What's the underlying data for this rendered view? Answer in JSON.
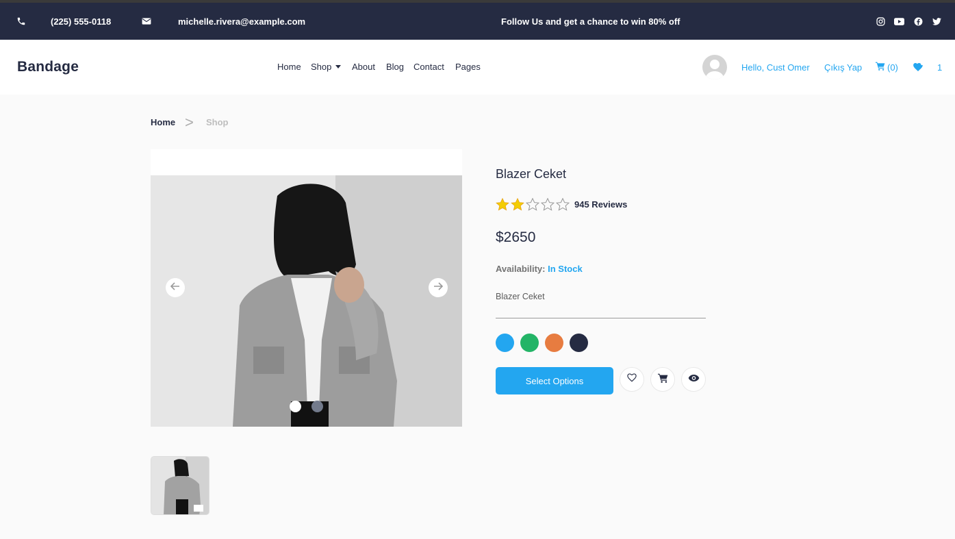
{
  "topbar": {
    "phone": "(225) 555-0118",
    "email": "michelle.rivera@example.com",
    "promo": "Follow Us  and get a chance to win 80% off",
    "icons": [
      "phone-icon",
      "mail-icon",
      "instagram-icon",
      "youtube-icon",
      "facebook-icon",
      "twitter-icon"
    ]
  },
  "header": {
    "logo": "Bandage",
    "nav": [
      {
        "label": "Home"
      },
      {
        "label": "Shop"
      },
      {
        "label": "About"
      },
      {
        "label": "Blog"
      },
      {
        "label": "Contact"
      },
      {
        "label": "Pages"
      }
    ],
    "greeting": "Hello, Cust Omer",
    "logout": "Çıkış Yap",
    "cart_count": "(0)",
    "wishlist_count": "1"
  },
  "breadcrumb": {
    "home": "Home",
    "separator": ">",
    "current": "Shop"
  },
  "product": {
    "title": "Blazer Ceket",
    "rating": 2,
    "rating_max": 5,
    "reviews": "945 Reviews",
    "price": "$2650",
    "availability_label": "Availability:",
    "availability_value": "In Stock",
    "description": "Blazer Ceket",
    "colors": [
      "#23a6f0",
      "#23856d",
      "#e77c40",
      "#252b42"
    ],
    "select_label": "Select Options"
  },
  "gallery": {
    "slides": 2,
    "active_slide": 1
  },
  "colors": {
    "primary": "#23a6f0",
    "dark": "#252b42",
    "star": "#f3cd03"
  }
}
